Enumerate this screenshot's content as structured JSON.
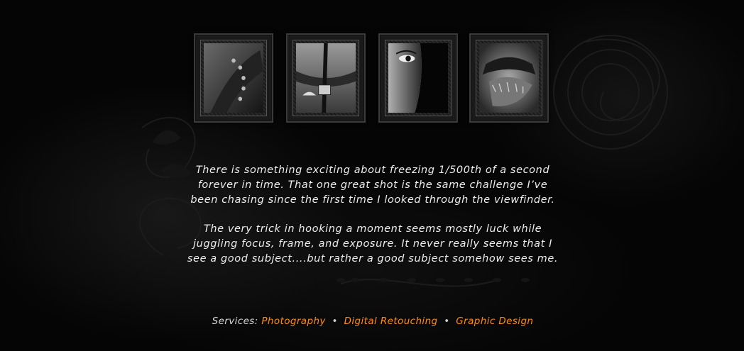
{
  "gallery": {
    "photos": [
      {
        "icon": "leather-strap-photo"
      },
      {
        "icon": "zipper-mouth-photo"
      },
      {
        "icon": "half-face-eye-photo"
      },
      {
        "icon": "fur-boot-photo"
      }
    ]
  },
  "intro": {
    "paragraph1_line1": "There is something exciting about freezing 1/500th of a second",
    "paragraph1_line2": "forever in time. That one great shot is the same challenge I’ve",
    "paragraph1_line3": "been chasing since the first time I looked through the viewfinder.",
    "paragraph2_line1": "The very trick in hooking a moment seems mostly luck while",
    "paragraph2_line2": "juggling focus, frame, and exposure. It never really seems that I",
    "paragraph2_line3": "see a good subject....but rather a good subject somehow sees me."
  },
  "services": {
    "label": "Services:",
    "separator": "•",
    "items": [
      "Photography",
      "Digital Retouching",
      "Graphic Design"
    ]
  },
  "colors": {
    "background": "#050505",
    "text": "#ededed",
    "link_accent": "#ff8c1a"
  }
}
